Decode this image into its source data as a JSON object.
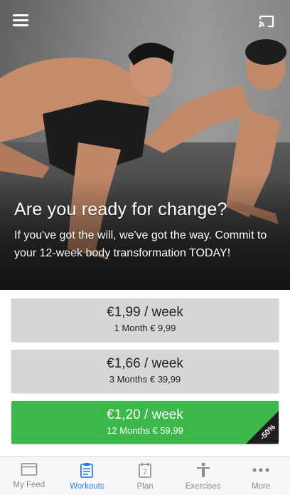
{
  "header": {
    "menu_icon": "hamburger-menu-icon",
    "cast_icon": "cast-icon"
  },
  "hero": {
    "headline": "Are you ready for change?",
    "subline": "If you've got the will, we've got the way. Commit to your 12-week body transformation TODAY!"
  },
  "plans": [
    {
      "price": "€1,99 / week",
      "total": "1 Month € 9,99"
    },
    {
      "price": "€1,66 / week",
      "total": "3 Months € 39,99"
    },
    {
      "price": "€1,20 / week",
      "total": "12 Months € 59,99",
      "badge": "-50%"
    }
  ],
  "tabs": [
    {
      "label": "My Feed",
      "icon": "feed-icon"
    },
    {
      "label": "Workouts",
      "icon": "clipboard-icon",
      "active": true
    },
    {
      "label": "Plan",
      "icon": "calendar-icon",
      "badge_text": "7"
    },
    {
      "label": "Exercises",
      "icon": "person-icon"
    },
    {
      "label": "More",
      "icon": "more-dots-icon"
    }
  ],
  "colors": {
    "accent_green": "#3cb84a",
    "active_tab_blue": "#2b7de0",
    "plan_grey": "#d6d6d6"
  }
}
